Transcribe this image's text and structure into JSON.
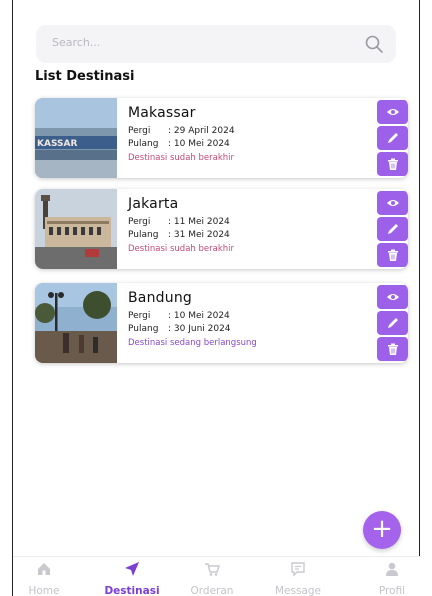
{
  "search": {
    "placeholder": "Search..."
  },
  "section_title": "List Destinasi",
  "destinations": [
    {
      "city": "Makassar",
      "pergi_label": "Pergi",
      "pergi_value": ": 29 April 2024",
      "pulang_label": "Pulang",
      "pulang_value": ": 10 Mei 2024",
      "status": "Destinasi sudah berakhir",
      "status_type": "ended",
      "thumb_sign": "KASSAR"
    },
    {
      "city": "Jakarta",
      "pergi_label": "Pergi",
      "pergi_value": ": 11 Mei 2024",
      "pulang_label": "Pulang",
      "pulang_value": ": 31 Mei 2024",
      "status": "Destinasi sudah berakhir",
      "status_type": "ended"
    },
    {
      "city": "Bandung",
      "pergi_label": "Pergi",
      "pergi_value": ": 10 Mei 2024",
      "pulang_label": "Pulang",
      "pulang_value": ": 30 Juni 2024",
      "status": "Destinasi sedang berlangsung",
      "status_type": "ongoing"
    }
  ],
  "card_actions": [
    "eye-icon",
    "pencil-icon",
    "trash-icon"
  ],
  "fab_icon": "plus-icon",
  "bottom_nav": [
    {
      "label": "Home",
      "icon": "home-icon",
      "active": false
    },
    {
      "label": "Destinasi",
      "icon": "send-icon",
      "active": true
    },
    {
      "label": "Orderan",
      "icon": "cart-icon",
      "active": false
    },
    {
      "label": "Message",
      "icon": "message-icon",
      "active": false
    },
    {
      "label": "Profil",
      "icon": "user-icon",
      "active": false
    }
  ],
  "colors": {
    "accent": "#9d60e8",
    "active_nav": "#7b3fd2",
    "status_ended": "#c54b74",
    "status_ongoing": "#8a48c8"
  }
}
